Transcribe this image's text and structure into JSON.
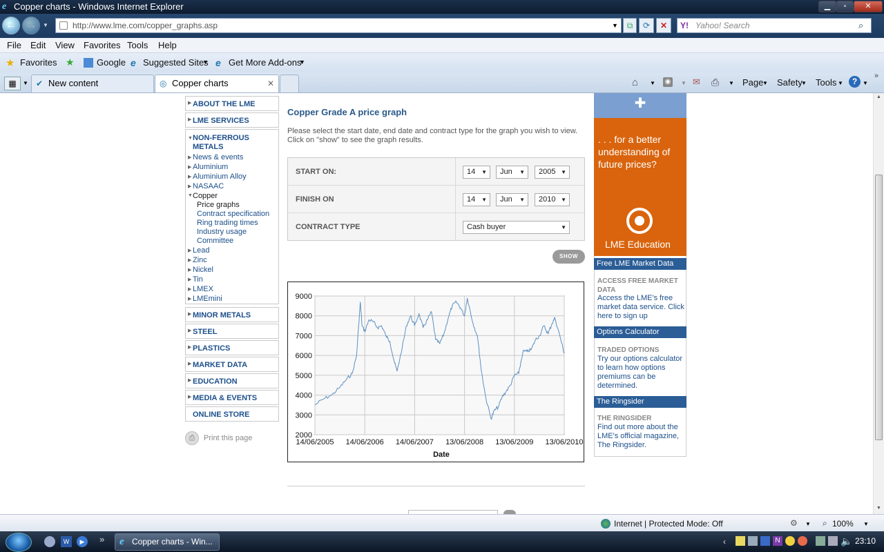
{
  "window": {
    "title": "Copper charts - Windows Internet Explorer",
    "min": "▁",
    "max": "▫",
    "close": "✕"
  },
  "address": {
    "url": "http://www.lme.com/copper_graphs.asp",
    "search_placeholder": "Yahoo! Search"
  },
  "menu": [
    "File",
    "Edit",
    "View",
    "Favorites",
    "Tools",
    "Help"
  ],
  "favbar": {
    "favorites": "Favorites",
    "google": "Google",
    "suggested": "Suggested Sites",
    "addons": "Get More Add-ons"
  },
  "tabs": [
    {
      "label": "New content"
    },
    {
      "label": "Copper charts"
    }
  ],
  "commandbar": {
    "page": "Page",
    "safety": "Safety",
    "tools": "Tools"
  },
  "leftnav": {
    "about": "ABOUT THE LME",
    "services": "LME SERVICES",
    "nonferrous_1": "NON-FERROUS",
    "nonferrous_2": "METALS",
    "sub": [
      "News & events",
      "Aluminium",
      "Aluminium Alloy",
      "NASAAC",
      "Copper"
    ],
    "copper_sub": [
      "Price graphs",
      "Contract specification",
      "Ring trading times",
      "Industry usage",
      "Committee"
    ],
    "sub2": [
      "Lead",
      "Zinc",
      "Nickel",
      "Tin",
      "LMEX",
      "LMEmini"
    ],
    "sections": [
      "MINOR METALS",
      "STEEL",
      "PLASTICS",
      "MARKET DATA",
      "EDUCATION",
      "MEDIA & EVENTS"
    ],
    "store": "ONLINE STORE",
    "print": "Print this page"
  },
  "main": {
    "title": "Copper Grade A price graph",
    "intro_1": "Please select the start date, end date and contract type for the graph you wish to view.",
    "intro_2": "Click on \"show\" to see the graph results.",
    "start_label": "START ON:",
    "finish_label": "FINISH ON",
    "contract_label": "CONTRACT TYPE",
    "start": {
      "day": "14",
      "month": "Jun",
      "year": "2005"
    },
    "finish": {
      "day": "14",
      "month": "Jun",
      "year": "2010"
    },
    "contract": "Cash buyer",
    "show": "SHOW"
  },
  "chart_data": {
    "type": "line",
    "title": "",
    "xlabel": "Date",
    "ylabel": "",
    "xticks": [
      "14/06/2005",
      "14/06/2006",
      "14/06/2007",
      "13/06/2008",
      "13/06/2009",
      "13/06/2010"
    ],
    "yticks": [
      2000,
      3000,
      4000,
      5000,
      6000,
      7000,
      8000,
      9000
    ],
    "ylim": [
      2000,
      9000
    ],
    "grid": true,
    "color": "#5b8fc2",
    "series": [
      {
        "x": [
          "2005-06-14",
          "2005-08-15",
          "2005-10-15",
          "2005-12-15",
          "2006-02-01",
          "2006-03-15",
          "2006-04-15",
          "2006-05-12",
          "2006-05-25",
          "2006-06-14",
          "2006-07-15",
          "2006-08-15",
          "2006-09-15",
          "2006-10-15",
          "2006-11-15",
          "2006-12-15",
          "2007-01-15",
          "2007-02-05",
          "2007-03-15",
          "2007-04-15",
          "2007-05-15",
          "2007-06-14",
          "2007-07-15",
          "2007-08-15",
          "2007-09-15",
          "2007-10-15",
          "2007-11-15",
          "2007-12-15",
          "2008-01-15",
          "2008-02-15",
          "2008-03-15",
          "2008-04-15",
          "2008-05-15",
          "2008-06-13",
          "2008-07-03",
          "2008-08-15",
          "2008-09-15",
          "2008-10-15",
          "2008-11-15",
          "2008-12-24",
          "2009-01-15",
          "2009-02-15",
          "2009-03-15",
          "2009-04-15",
          "2009-05-15",
          "2009-06-13",
          "2009-07-15",
          "2009-08-15",
          "2009-09-15",
          "2009-10-15",
          "2009-11-15",
          "2009-12-15",
          "2010-01-15",
          "2010-02-15",
          "2010-03-15",
          "2010-04-06",
          "2010-05-15",
          "2010-06-13"
        ],
        "values": [
          3500,
          3800,
          4000,
          4400,
          4800,
          5100,
          6000,
          8700,
          7500,
          7200,
          7800,
          7700,
          7400,
          7500,
          7000,
          6700,
          5700,
          5200,
          6400,
          7500,
          8000,
          7500,
          8100,
          7400,
          7800,
          8200,
          6800,
          6600,
          7100,
          7900,
          8500,
          8700,
          8400,
          8000,
          8900,
          7600,
          7000,
          5200,
          3900,
          2800,
          3200,
          3400,
          3900,
          4200,
          4500,
          5000,
          5100,
          6200,
          6200,
          6300,
          6800,
          7000,
          7500,
          7100,
          7600,
          7900,
          6900,
          6100
        ]
      }
    ]
  },
  "rightcol": {
    "ad_text": ". . . for a better understanding of future prices?",
    "ad_brand": "LME Education",
    "box1_head": "Free LME Market Data",
    "box1_cap": "ACCESS FREE MARKET DATA",
    "box1_text": "Access the LME's free market data service. Click here to sign up",
    "box2_head": "Options Calculator",
    "box2_cap": "TRADED OPTIONS",
    "box2_text": "Try our options calculator to learn how options premiums can be determined.",
    "box3_head": "The Ringsider",
    "box3_cap": "THE RINGSIDER",
    "box3_text": "Find out more about the LME's official magazine, The Ringsider."
  },
  "status": {
    "zone": "Internet | Protected Mode: Off",
    "zoom": "100%"
  },
  "taskbar": {
    "window": "Copper charts - Win...",
    "time": "23:10"
  }
}
